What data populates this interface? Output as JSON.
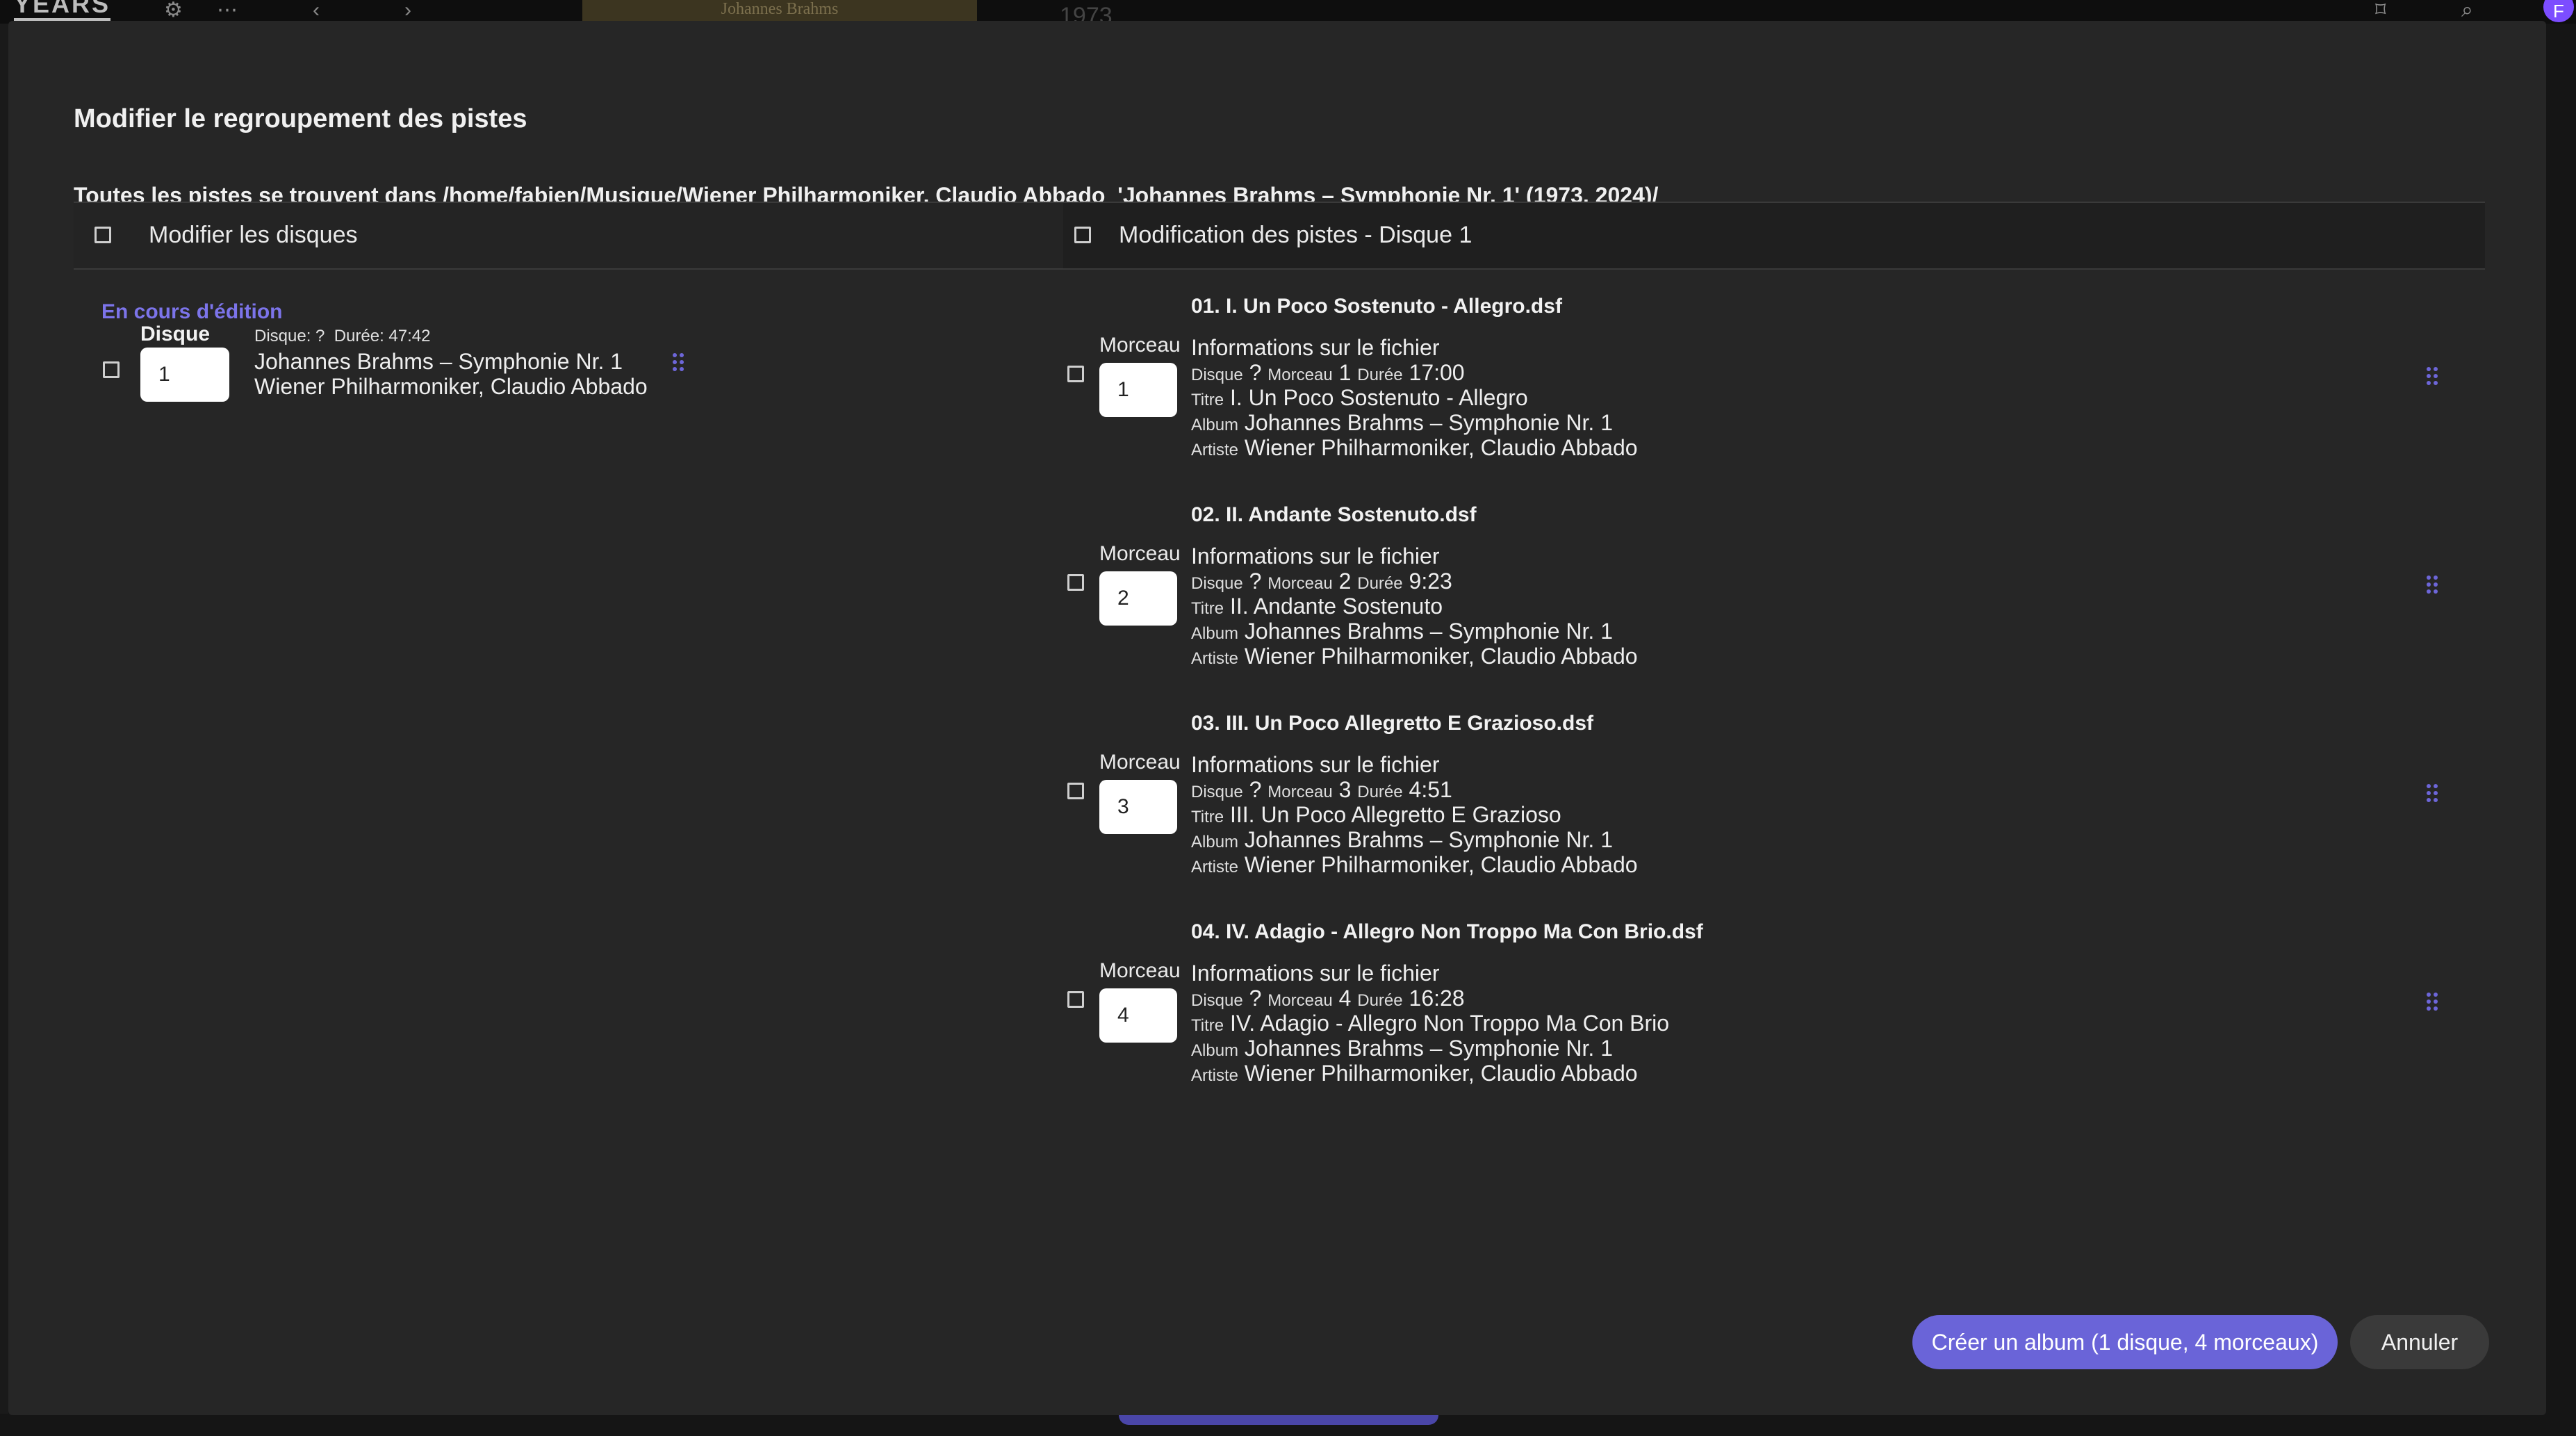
{
  "background": {
    "logo": "YEARS",
    "cover_text": "Johannes Brahms",
    "year_text": "1973",
    "avatar": "F"
  },
  "dialog": {
    "title": "Modifier le regroupement des pistes",
    "path_text": "Toutes les pistes se trouvent dans /home/fabien/Musique/Wiener Philharmoniker, Claudio Abbado  'Johannes Brahms – Symphonie Nr. 1' (1973, 2024)/",
    "discs_header": "Modifier les disques",
    "tracks_header": "Modification des pistes - Disque 1",
    "editing_label": "En cours d'édition",
    "disc": {
      "label": "Disque",
      "value": "1",
      "meta": "Disque: ?  Durée: 47:42",
      "album": "Johannes Brahms – Symphonie Nr. 1",
      "artist": "Wiener Philharmoniker, Claudio Abbado"
    },
    "track_label": "Morceau",
    "file_info_label": "Informations sur le fichier",
    "keys": {
      "disc": "Disque",
      "track": "Morceau",
      "duration": "Durée",
      "title": "Titre",
      "album": "Album",
      "artist": "Artiste"
    },
    "tracks": [
      {
        "file": "01. I. Un Poco Sostenuto - Allegro.dsf",
        "number": "1",
        "disc": "?",
        "track": "1",
        "duration": "17:00",
        "title": "I. Un Poco Sostenuto - Allegro",
        "album": "Johannes Brahms – Symphonie Nr. 1",
        "artist": "Wiener Philharmoniker, Claudio Abbado"
      },
      {
        "file": "02. II. Andante Sostenuto.dsf",
        "number": "2",
        "disc": "?",
        "track": "2",
        "duration": "9:23",
        "title": "II. Andante Sostenuto",
        "album": "Johannes Brahms – Symphonie Nr. 1",
        "artist": "Wiener Philharmoniker, Claudio Abbado"
      },
      {
        "file": "03. III. Un Poco Allegretto E Grazioso.dsf",
        "number": "3",
        "disc": "?",
        "track": "3",
        "duration": "4:51",
        "title": "III. Un Poco Allegretto E Grazioso",
        "album": "Johannes Brahms – Symphonie Nr. 1",
        "artist": "Wiener Philharmoniker, Claudio Abbado"
      },
      {
        "file": "04. IV. Adagio - Allegro Non Troppo Ma Con Brio.dsf",
        "number": "4",
        "disc": "?",
        "track": "4",
        "duration": "16:28",
        "title": "IV. Adagio - Allegro Non Troppo Ma Con Brio",
        "album": "Johannes Brahms – Symphonie Nr. 1",
        "artist": "Wiener Philharmoniker, Claudio Abbado"
      }
    ],
    "create_button": "Créer un album (1 disque, 4 morceaux)",
    "cancel_button": "Annuler"
  }
}
